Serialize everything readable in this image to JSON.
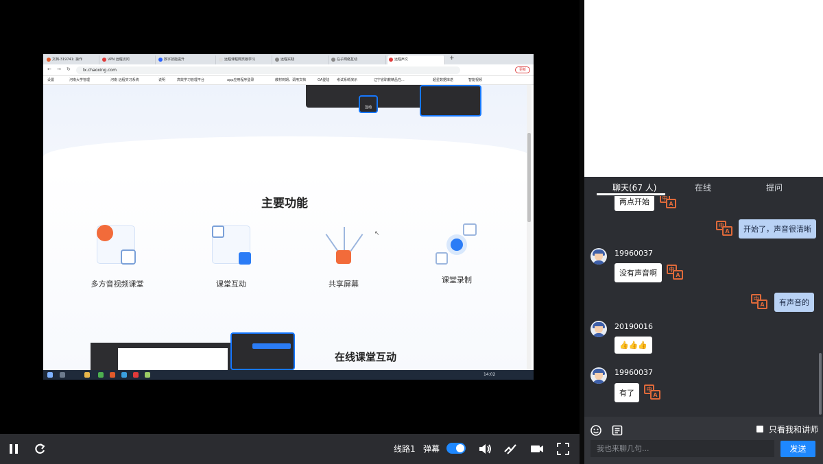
{
  "browser": {
    "tabs": [
      {
        "label": "文档-319741: 操作",
        "color": "#e05a2b"
      },
      {
        "label": "VPN 远程访问",
        "color": "#e03a3a"
      },
      {
        "label": "数字技能提升",
        "color": "#2962ff"
      },
      {
        "label": "远程课程网页版学习",
        "color": "#dddddd"
      },
      {
        "label": "远程实践",
        "color": "#888888"
      },
      {
        "label": "在子网络互动",
        "color": "#888888"
      },
      {
        "label": "远程声文",
        "color": "#e03a3a"
      }
    ],
    "new_tab": "+",
    "url": "lx.chaoxing.com",
    "update_label": "更新",
    "bookmarks": [
      "设置",
      "河南大学管理",
      "河南 远程实习系统",
      "说明",
      "高效学习管理平台",
      "app应用程序登录",
      "教材到期，调用文档",
      "OA登陆",
      "考试系统演示",
      "辽宁省职教精品在...",
      "超星数据库迭",
      "智能视频"
    ]
  },
  "page": {
    "popup_label": "互动",
    "section_title": "主要功能",
    "features": [
      {
        "label": "多方音视频课堂",
        "icon": "video-call-icon"
      },
      {
        "label": "课堂互动",
        "icon": "chat-interaction-icon"
      },
      {
        "label": "共享屏幕",
        "icon": "screen-share-icon"
      },
      {
        "label": "课堂录制",
        "icon": "record-mic-icon"
      }
    ],
    "bottom_title": "在线课堂互动",
    "taskbar_time": "14:02"
  },
  "controls": {
    "line_label": "线路1",
    "danmu_label": "弹幕",
    "danmu_on": true
  },
  "right_panel": {
    "tabs": [
      "聊天(67 人)",
      "在线",
      "提问"
    ],
    "messages": [
      {
        "type": "other",
        "user": "",
        "text": "两点开始"
      },
      {
        "type": "self",
        "text": "开始了，声音很清晰"
      },
      {
        "type": "other",
        "user": "19960037",
        "text": "没有声音啊"
      },
      {
        "type": "self",
        "text": "有声音的"
      },
      {
        "type": "other",
        "user": "20190016",
        "text": "👍👍👍"
      },
      {
        "type": "other",
        "user": "19960037",
        "text": "有了"
      }
    ],
    "only_teacher_label": "只看我和讲师",
    "input_placeholder": "我也来聊几句...",
    "send_label": "发送",
    "translate_glyph_a": "中",
    "translate_glyph_b": "A"
  },
  "colors": {
    "accent": "#1e88ff",
    "translate": "#e06a3a",
    "panel_bg": "#2c2e33"
  }
}
